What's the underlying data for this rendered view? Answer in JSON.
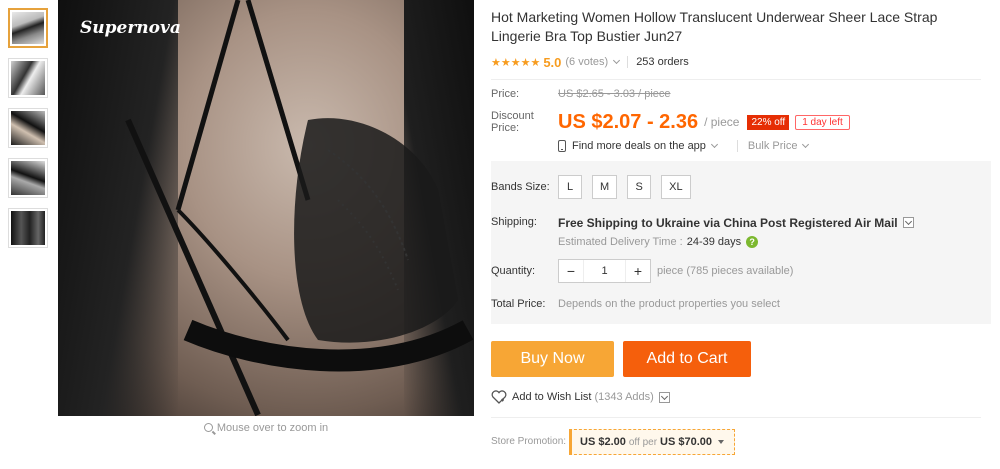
{
  "gallery": {
    "brand_watermark": "Supernova",
    "zoom_hint": "Mouse over to zoom in",
    "thumbnails": [
      "thumb-1",
      "thumb-2",
      "thumb-3",
      "thumb-4",
      "thumb-5"
    ]
  },
  "product": {
    "title": "Hot Marketing Women Hollow Translucent Underwear Sheer Lace Strap Lingerie Bra Top Bustier Jun27",
    "stars": "★★★★★",
    "rating": "5.0",
    "votes": "(6 votes)",
    "orders": "253 orders"
  },
  "price": {
    "price_label": "Price:",
    "original": "US $2.65 - 3.03 / piece",
    "discount_label": "Discount Price:",
    "discount": "US $2.07 - 2.36",
    "per_piece": "/ piece",
    "off_badge": "22% off",
    "time_left": "1 day left",
    "app_deals": "Find more deals on the app",
    "bulk_price": "Bulk Price"
  },
  "options": {
    "sizes_label": "Bands Size:",
    "sizes": [
      "L",
      "M",
      "S",
      "XL"
    ],
    "shipping_label": "Shipping:",
    "shipping_text": "Free Shipping to Ukraine via China Post Registered Air Mail",
    "delivery_label": "Estimated Delivery Time :",
    "delivery_days": "24-39  days",
    "quantity_label": "Quantity:",
    "quantity_value": "1",
    "quantity_avail": "piece (785 pieces available)",
    "total_label": "Total Price:",
    "total_value": "Depends on the product properties you select"
  },
  "actions": {
    "buy_now": "Buy Now",
    "add_to_cart": "Add to Cart",
    "wishlist": "Add to Wish List",
    "wishlist_count": "(1343 Adds)"
  },
  "promotion": {
    "label": "Store Promotion:",
    "amount": "US $2.00",
    "per_text": "off per",
    "threshold": "US $70.00"
  },
  "colors": {
    "accent_orange": "#f60",
    "buy_now": "#f7a635",
    "add_to_cart": "#f55f0c",
    "star": "#f79c1f"
  }
}
